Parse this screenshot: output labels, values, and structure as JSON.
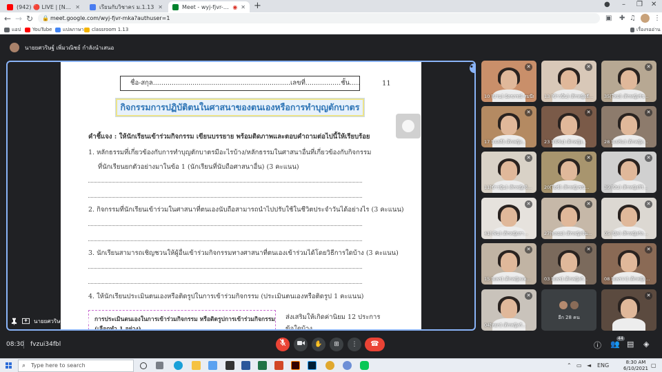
{
  "browser": {
    "tabs": [
      {
        "title": "(942) 🔴 LIVE | [NEW] เพลงญี่ปุ่น",
        "color": "#ff0000"
      },
      {
        "title": "เรียนกับวิชาคร ม.1.13",
        "color": "#4a7cf0"
      },
      {
        "title": "Meet - wyj-fjvr-mka",
        "color": "#00832d"
      }
    ],
    "url": "meet.google.com/wyj-fjvr-mka?authuser=1",
    "bookmarks": [
      {
        "label": "แอป",
        "color": "#5f6368"
      },
      {
        "label": "YouTube",
        "color": "#ff0000"
      },
      {
        "label": "แปลภาษา",
        "color": "#4285f4"
      },
      {
        "label": "classroom 1.13",
        "color": "#f4b400"
      }
    ],
    "reading_list": "เรื่องรออ่าน"
  },
  "meet": {
    "presenter_text": "นายยศวริษฐ์ เพิ่มวณิชย์ กำลังนำเสนอ",
    "presenter_label": "นายยศวริษฐ์ เพิ่มวณิชย์",
    "time": "08:30",
    "meeting_code": "fvzui34fbl",
    "participant_badge": "44",
    "others_count": "อีก 28 คน",
    "participants": [
      {
        "name": "10 [ปาน] ฉัตรภรณ์ สมนึก",
        "bg": "#c98f6a"
      },
      {
        "name": "13 [ข้าวปั้น] เด็กหญิงธี...",
        "bg": "#d8c8b8"
      },
      {
        "name": "35[ใหม่] เด็กหญิงรัช...",
        "bg": "#b7a893"
      },
      {
        "name": "17 [เจลลี่] เด็กหญิง...",
        "bg": "#b48a62"
      },
      {
        "name": "23 [เฟิร์น] เด็กหญิง...",
        "bg": "#7a5a48"
      },
      {
        "name": "28 [แปร์ม] เด็กหญิง...",
        "bg": "#8d7b6c"
      },
      {
        "name": "11[ข้าวปุ้น] เด็กหญิงจิ...",
        "bg": "#d9d2c7"
      },
      {
        "name": "20[ไอซ์] เด็กหญิงชนั...",
        "bg": "#a8956e"
      },
      {
        "name": "39 [ปัน] เด็กหญิงสิริ...",
        "bg": "#d0d0d0"
      },
      {
        "name": "41[เฟิน] เด็กหญิงสา...",
        "bg": "#e6e2dd"
      },
      {
        "name": "27[พลอย] เด็กหญิงจิน...",
        "bg": "#c6b8a8"
      },
      {
        "name": "05 [บุ๊ค] เด็กหญิงกัล...",
        "bg": "#dcd8d2"
      },
      {
        "name": "15 [แพร] เด็กหญิงแพ...",
        "bg": "#c1b4a4"
      },
      {
        "name": "03 [แพร] เด็กหญิงกั...",
        "bg": "#7b6a5c"
      },
      {
        "name": "08 [แพรวา] เด็กหญิง...",
        "bg": "#8a6a55"
      },
      {
        "name": "04[หยก] เด็กหญิงกั...",
        "bg": "#c9c3bb"
      },
      {
        "name": "",
        "bg": "#5b4a3f"
      }
    ]
  },
  "document": {
    "name_line": "ชื่อ-สกุล..................................................................เลขที่.................ชั้น......................",
    "page_number": "11",
    "title": "กิจกรรมการปฏิบัติตนในศาสนาของตนเองหรือการทำบุญตักบาตร",
    "instruction": "คำชี้แจง : ให้นักเรียนเข้าร่วมกิจกรรม เขียนบรรยาย พร้อมติดภาพและตอบคำถามต่อไปนี้ให้เรียบร้อย",
    "q1a": "1. หลักธรรมที่เกี่ยวข้องกับการทำบุญตักบาตรมีอะไรบ้าง/หลักธรรมในศาสนาอื่นที่เกี่ยวข้องกับกิจกรรม",
    "q1b": "ที่นักเรียนยกตัวอย่างมาในข้อ 1 (นักเรียนที่นับถือศาสนาอื่น) (3 คะแนน)",
    "q2": "2. กิจกรรมที่นักเรียนเข้าร่วมในศาสนาที่ตนเองนับถือสามารถนำไปปรับใช้ในชีวิตประจำวันได้อย่างไร (3 คะแนน)",
    "q3": "3. นักเรียนสามารถเชิญชวนให้ผู้อื่นเข้าร่วมกิจกรรมทางศาสนาที่ตนเองเข้าร่วมได้โดยวิธีการใดบ้าง (3 คะแนน)",
    "q4": "4. ให้นักเรียนประเมินตนเองหรือติดรูปในการเข้าร่วมกิจกรรม (ประเมินตนเองหรือติดรูป 1 คะแนน)",
    "eval_line1": "การประเมินตนเองในการเข้าร่วมกิจกรรม หรือติดรูปการเข้าร่วมกิจกรรม",
    "eval_line2": "(เลือกทำ 1 อย่าง)",
    "note_line1": "ส่งเสริมให้เกิดค่านิยม 12 ประการ",
    "note_line2": "ข้อใดบ้าง"
  },
  "taskbar": {
    "search_placeholder": "Type here to search",
    "time": "8:30 AM",
    "date": "6/10/2021",
    "lang": "ENG"
  }
}
